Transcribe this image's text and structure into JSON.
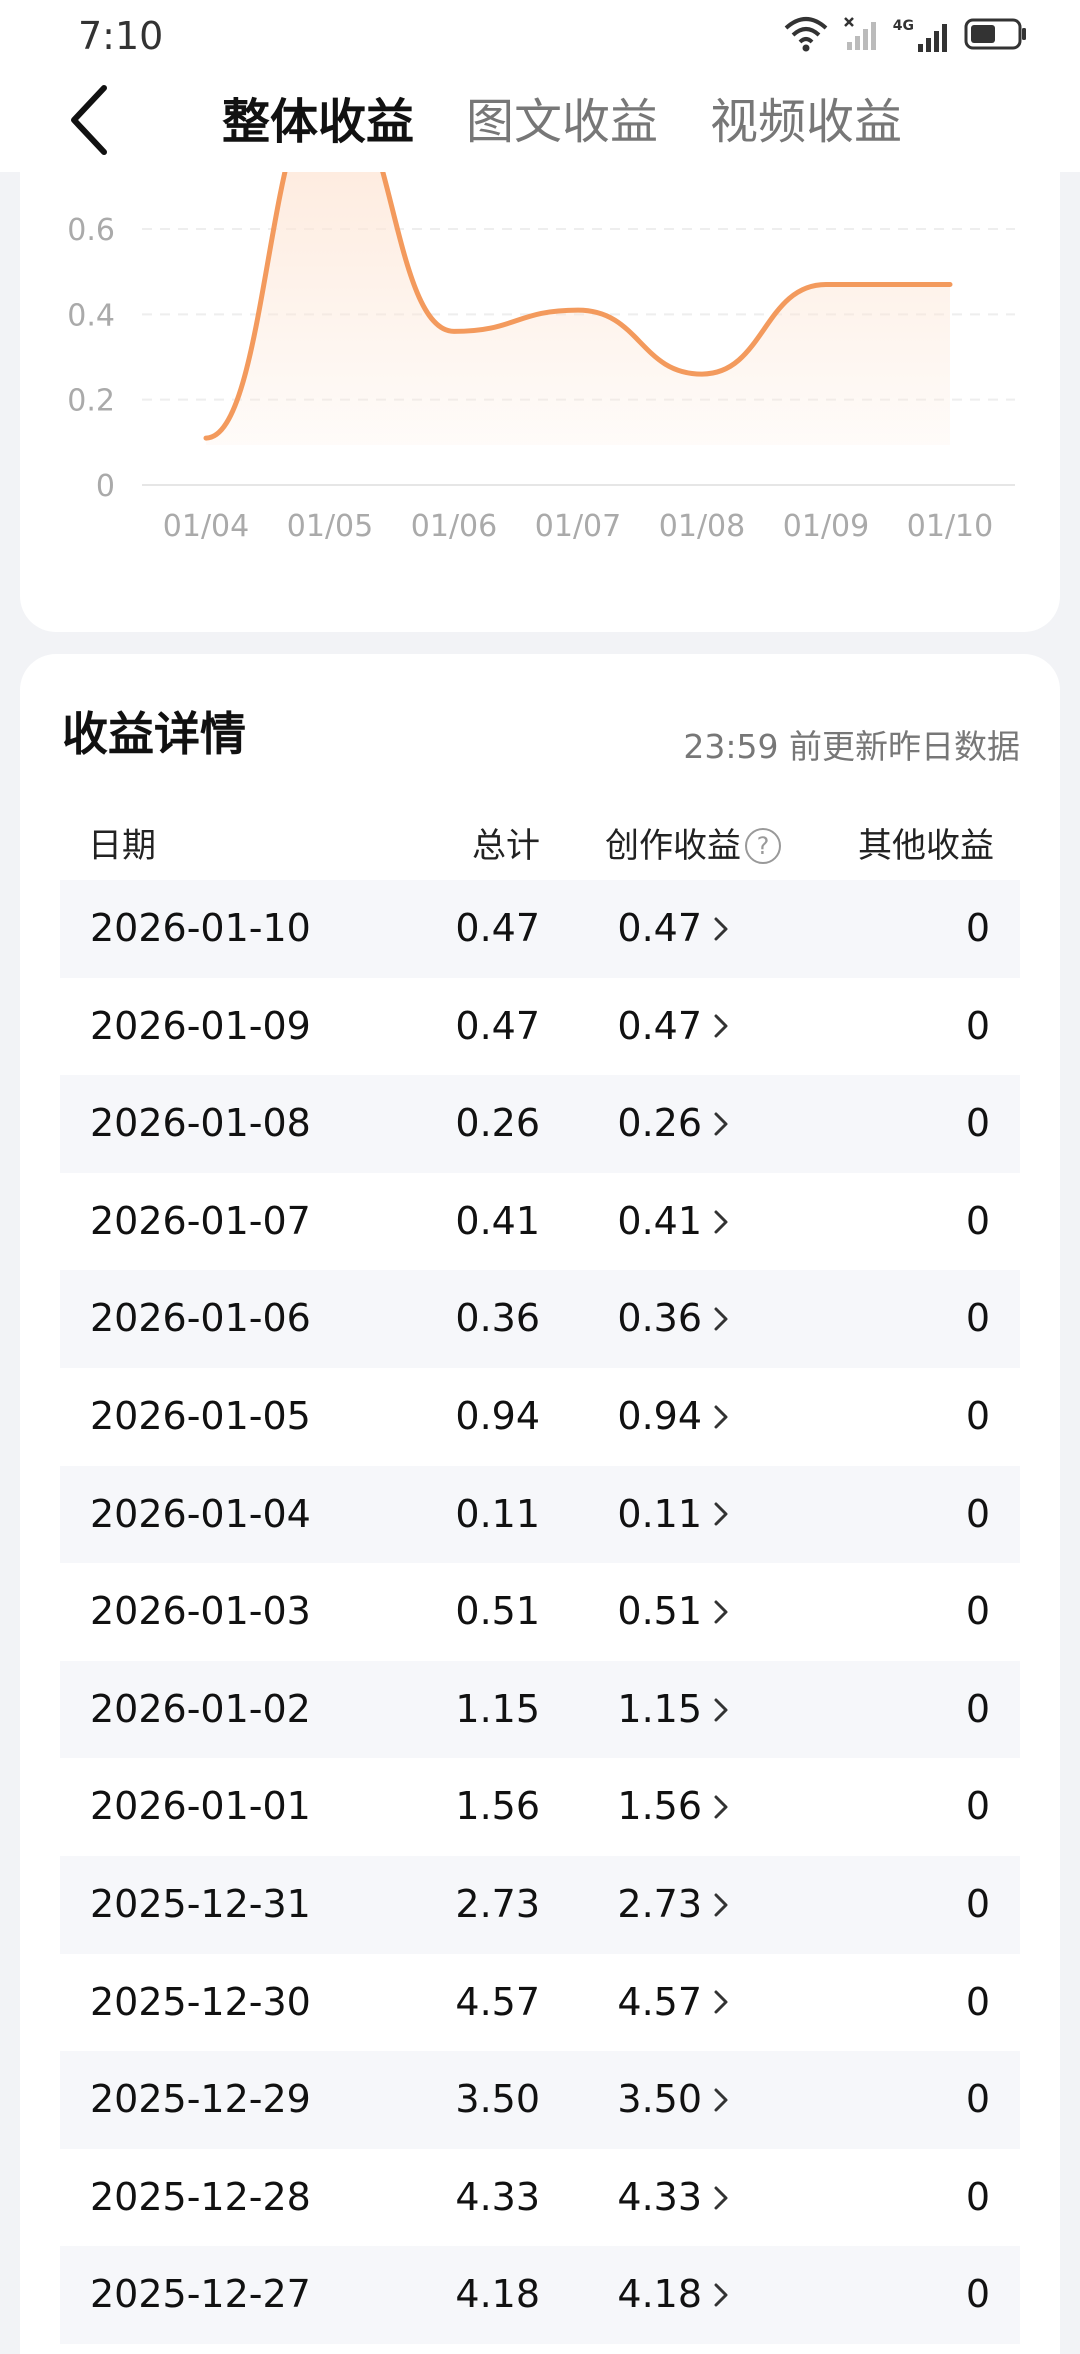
{
  "status": {
    "time": "7:10",
    "network": "4G"
  },
  "nav": {
    "tabs": [
      {
        "label": "整体收益",
        "active": true
      },
      {
        "label": "图文收益",
        "active": false
      },
      {
        "label": "视频收益",
        "active": false
      }
    ]
  },
  "chart_data": {
    "type": "area",
    "categories": [
      "01/04",
      "01/05",
      "01/06",
      "01/07",
      "01/08",
      "01/09",
      "01/10"
    ],
    "values": [
      0.11,
      0.94,
      0.36,
      0.41,
      0.26,
      0.47,
      0.47
    ],
    "y_ticks": [
      "0",
      "0.2",
      "0.4",
      "0.6"
    ],
    "ylim": [
      0,
      0.6
    ],
    "grid": true,
    "line_color": "#f39a5d",
    "fill_color": "#fde6d6"
  },
  "details": {
    "title": "收益详情",
    "update_note": "23:59 前更新昨日数据",
    "headers": {
      "date": "日期",
      "total": "总计",
      "creation": "创作收益",
      "other": "其他收益"
    },
    "rows": [
      {
        "date": "2026-01-10",
        "total": "0.47",
        "creation": "0.47",
        "other": "0"
      },
      {
        "date": "2026-01-09",
        "total": "0.47",
        "creation": "0.47",
        "other": "0"
      },
      {
        "date": "2026-01-08",
        "total": "0.26",
        "creation": "0.26",
        "other": "0"
      },
      {
        "date": "2026-01-07",
        "total": "0.41",
        "creation": "0.41",
        "other": "0"
      },
      {
        "date": "2026-01-06",
        "total": "0.36",
        "creation": "0.36",
        "other": "0"
      },
      {
        "date": "2026-01-05",
        "total": "0.94",
        "creation": "0.94",
        "other": "0"
      },
      {
        "date": "2026-01-04",
        "total": "0.11",
        "creation": "0.11",
        "other": "0"
      },
      {
        "date": "2026-01-03",
        "total": "0.51",
        "creation": "0.51",
        "other": "0"
      },
      {
        "date": "2026-01-02",
        "total": "1.15",
        "creation": "1.15",
        "other": "0"
      },
      {
        "date": "2026-01-01",
        "total": "1.56",
        "creation": "1.56",
        "other": "0"
      },
      {
        "date": "2025-12-31",
        "total": "2.73",
        "creation": "2.73",
        "other": "0"
      },
      {
        "date": "2025-12-30",
        "total": "4.57",
        "creation": "4.57",
        "other": "0"
      },
      {
        "date": "2025-12-29",
        "total": "3.50",
        "creation": "3.50",
        "other": "0"
      },
      {
        "date": "2025-12-28",
        "total": "4.33",
        "creation": "4.33",
        "other": "0"
      },
      {
        "date": "2025-12-27",
        "total": "4.18",
        "creation": "4.18",
        "other": "0"
      }
    ]
  },
  "icons": {
    "back": "back-arrow-icon",
    "wifi": "wifi-icon",
    "signal": "signal-icon",
    "battery": "battery-icon",
    "help": "question-circle-icon",
    "row_chevron": "chevron-right-icon"
  }
}
